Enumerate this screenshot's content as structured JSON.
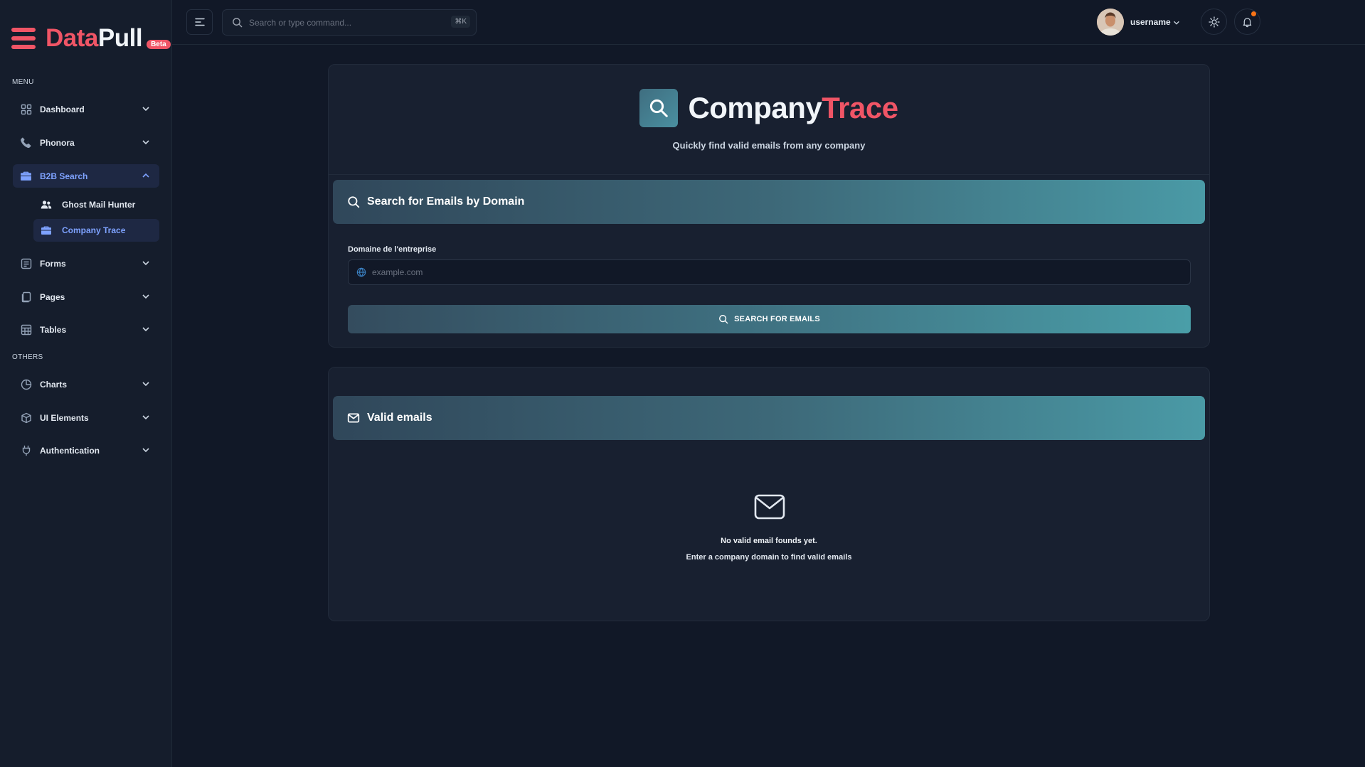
{
  "brand": {
    "name_part1": "Data",
    "name_part2": "Pull",
    "badge": "Beta"
  },
  "sidebar": {
    "menu_title": "MENU",
    "others_title": "OTHERS",
    "items": [
      {
        "label": "Dashboard",
        "icon": "grid-icon"
      },
      {
        "label": "Phonora",
        "icon": "phone-icon"
      },
      {
        "label": "B2B Search",
        "icon": "briefcase-icon",
        "active": true
      },
      {
        "label": "Forms",
        "icon": "form-icon"
      },
      {
        "label": "Pages",
        "icon": "pages-icon"
      },
      {
        "label": "Tables",
        "icon": "table-icon"
      },
      {
        "label": "Charts",
        "icon": "pie-chart-icon"
      },
      {
        "label": "UI Elements",
        "icon": "box-icon"
      },
      {
        "label": "Authentication",
        "icon": "plug-icon"
      }
    ],
    "sub_items": [
      {
        "label": "Ghost Mail Hunter",
        "icon": "users-icon"
      },
      {
        "label": "Company Trace",
        "icon": "briefcase-icon",
        "active": true
      }
    ]
  },
  "header": {
    "search_placeholder": "Search or type command...",
    "shortcut": "⌘K",
    "username": "username"
  },
  "hero": {
    "title_part1": "Company",
    "title_part2": "Trace",
    "subtitle": "Quickly find valid emails from any company"
  },
  "search_panel": {
    "title": "Search for Emails by Domain",
    "field_label": "Domaine de l'entreprise",
    "field_placeholder": "example.com",
    "field_value": "",
    "button_label": "SEARCH FOR EMAILS"
  },
  "results_panel": {
    "title": "Valid emails",
    "empty_title": "No valid email founds yet.",
    "empty_subtitle": "Enter a company domain to find valid emails"
  },
  "colors": {
    "accent_red": "#f05566",
    "active_blue": "#7ea2ff",
    "teal_gradient_start": "#30475a",
    "teal_gradient_end": "#4a9aa6",
    "background": "#111827",
    "panel": "#182030"
  }
}
